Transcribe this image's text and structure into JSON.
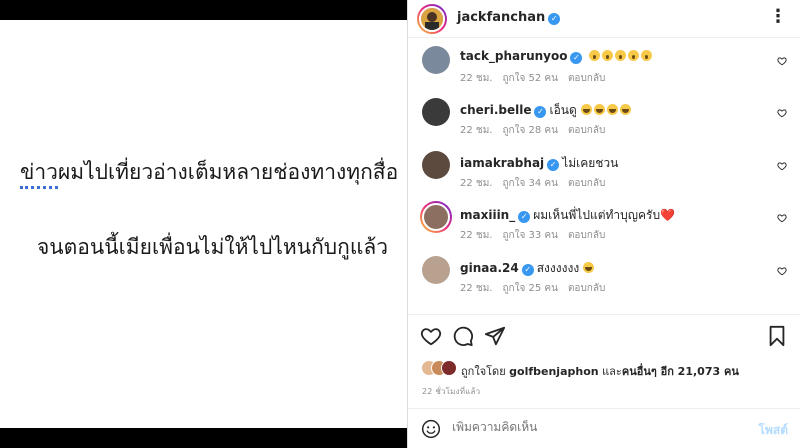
{
  "media": {
    "line1": "ข่าวผมไปเที่ยวอ่างเต็มหลายช่องทางทุกสื่อ",
    "line1_underlined": "ข่าว",
    "line1_rest": "ผมไปเที่ยวอ่างเต็มหลายช่องทางทุกสื่อ",
    "line2": "จนตอนนี้เมียเพื่อนไม่ให้ไปไหนกับกูแล้ว"
  },
  "header": {
    "username": "jackfanchan",
    "more_label": "⋮"
  },
  "comments": [
    {
      "user": "tack_pharunyoo",
      "verified": true,
      "text": "",
      "emoji": [
        "wow",
        "wow",
        "wow",
        "wow",
        "wow"
      ],
      "time": "22 ชม.",
      "likes": "ถูกใจ 52 คน",
      "reply": "ตอบกลับ",
      "avatar_color": "#7a8a9c"
    },
    {
      "user": "cheri.belle",
      "verified": true,
      "text": "เอ็นดู",
      "emoji": [
        "laugh",
        "laugh",
        "laugh",
        "laugh"
      ],
      "time": "22 ชม.",
      "likes": "ถูกใจ 28 คน",
      "reply": "ตอบกลับ",
      "avatar_color": "#3a3a3a"
    },
    {
      "user": "iamakrabhaj",
      "verified": true,
      "text": "ไม่เคยชวน",
      "emoji": [],
      "time": "22 ชม.",
      "likes": "ถูกใจ 34 คน",
      "reply": "ตอบกลับ",
      "avatar_color": "#5d4a3e"
    },
    {
      "user": "maxiiin_",
      "verified": true,
      "text": "ผมเห็นพี่ไปแต่ทำบุญครับ❤️",
      "emoji": [],
      "time": "22 ชม.",
      "likes": "ถูกใจ 33 คน",
      "reply": "ตอบกลับ",
      "avatar_color": "#8c6f60",
      "story_ring": true
    },
    {
      "user": "ginaa.24",
      "verified": true,
      "text": "สงงงงงง",
      "emoji": [
        "laugh"
      ],
      "time": "22 ชม.",
      "likes": "ถูกใจ 25 คน",
      "reply": "ตอบกลับ",
      "avatar_color": "#b9a18f"
    }
  ],
  "likes": {
    "prefix": "ถูกใจโดย",
    "user": "golfbenjaphon",
    "middle": "และ",
    "others": "คนอื่นๆ อีก 21,073 คน"
  },
  "time_ago": "22 ชั่วโมงที่แล้ว",
  "add_comment": {
    "placeholder": "เพิ่มความคิดเห็น",
    "post_label": "โพสต์"
  },
  "icons": {
    "like": "heart-icon",
    "comment": "comment-icon",
    "share": "share-icon",
    "save": "bookmark-icon",
    "emoji": "emoji-icon",
    "more": "more-icon"
  },
  "colors": {
    "verified": "#3897f0",
    "muted": "#8e8e8e",
    "post_disabled": "#b3dbff"
  }
}
